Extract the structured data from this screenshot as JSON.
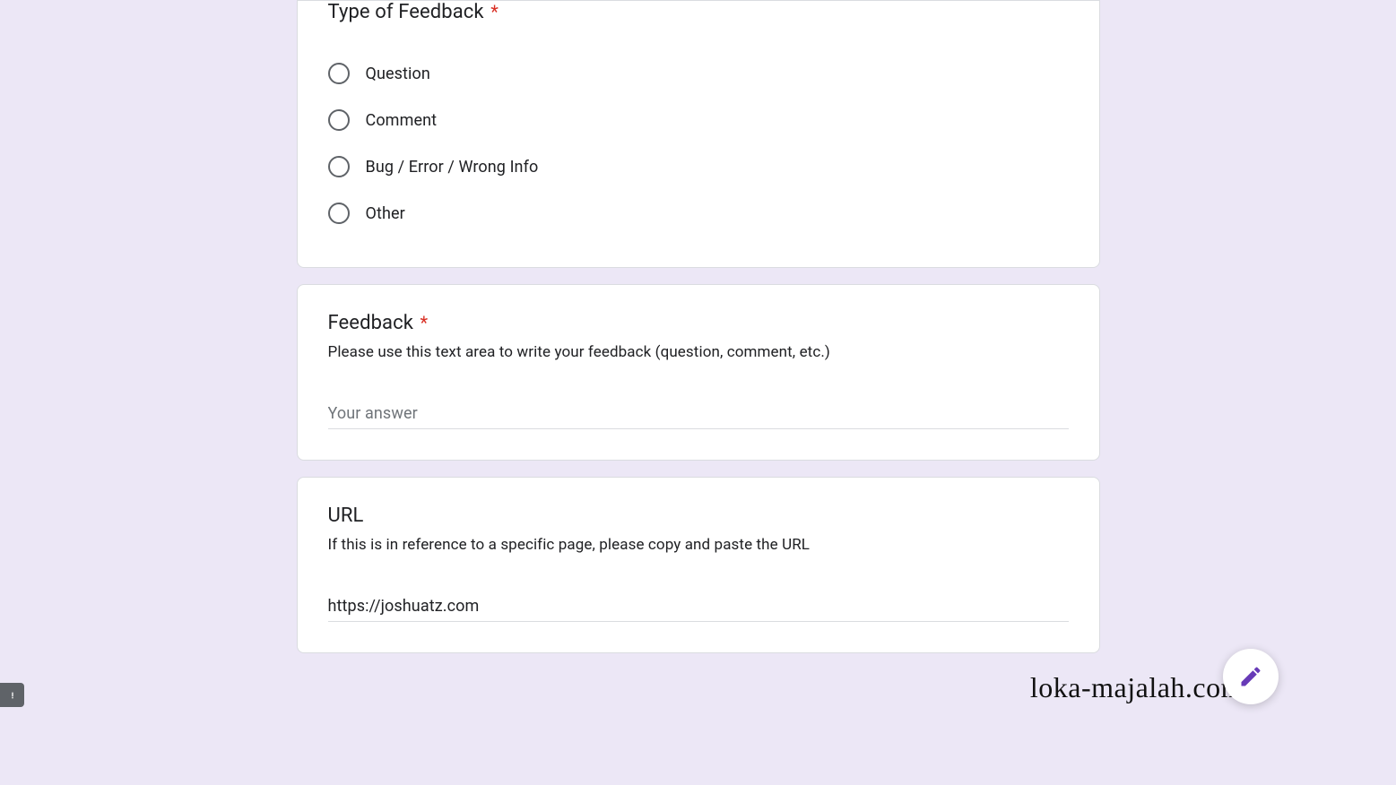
{
  "questions": {
    "type_of_feedback": {
      "title": "Type of Feedback",
      "required_marker": "*",
      "options": [
        "Question",
        "Comment",
        "Bug / Error / Wrong Info",
        "Other"
      ]
    },
    "feedback": {
      "title": "Feedback",
      "required_marker": "*",
      "description": "Please use this text area to write your feedback (question, comment, etc.)",
      "placeholder": "Your answer",
      "value": ""
    },
    "url": {
      "title": "URL",
      "description": "If this is in reference to a specific page, please copy and paste the URL",
      "value": "https://joshuatz.com"
    }
  },
  "watermark": "loka-majalah.com"
}
